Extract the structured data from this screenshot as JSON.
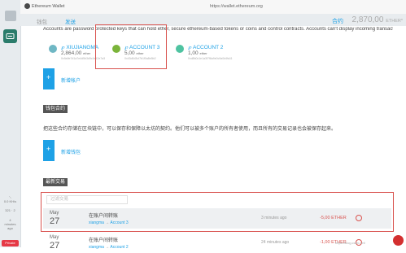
{
  "window": {
    "title": "Ethereum Wallet",
    "url": "https://wallet.ethereum.org"
  },
  "nav": {
    "wallets": "钱包",
    "send": "发送",
    "contracts": "合约",
    "balance": "2,870,00",
    "balance_unit": "ETHER*"
  },
  "sidebar": {
    "peers": "0.0 KH/s",
    "blocks": "321 · 2",
    "time": "4 minutes ago",
    "badge": "Private"
  },
  "info_line": "Accounts are password protected keys that can hold ether, secure ethereum-based tokens or coins and control contracts. Accounts can't display incoming transactions.",
  "accounts": [
    {
      "name": "℘ XIUJIANGMA",
      "balance": "2,864,00",
      "unit": "ether",
      "address": "0x9a9e7d1a7e4d5b3d9c1e12e7a3"
    },
    {
      "name": "℘ ACCOUNT 3",
      "balance": "5,00",
      "unit": "ether",
      "address": "0x43d0d3cf7b1f0a8e5b2"
    },
    {
      "name": "℘ ACCOUNT 2",
      "balance": "1,00",
      "unit": "ether",
      "address": "0xd8b0c1e1a3f7f6a9e0c9a0d4fa11"
    }
  ],
  "new_account": "新增帐户",
  "wallet_contracts": {
    "heading": "钱包合约",
    "description": "把这些合约存储在区块链中，可以保存和保障以太坊的契约。他们可以被多个账户的所有者使用，而且所有的交易记录也会被保存起来。",
    "add_label": "新增钱包"
  },
  "transactions": {
    "heading": "最新交易",
    "filter_placeholder": "过滤交易",
    "rows": [
      {
        "month": "May",
        "day": "27",
        "title": "在账户间转账",
        "from": "xiangma",
        "to": "Account 3",
        "time": "3 minutes ago",
        "amount": "-5,00 ETHER"
      },
      {
        "month": "May",
        "day": "27",
        "title": "在账户间转账",
        "from": "xiangma",
        "to": "Account 2",
        "time": "24 minutes ago",
        "amount": "-1,00 ETHER"
      }
    ]
  },
  "plus": "+",
  "arrow": "→",
  "watermark": "https://blog.csdn.net/",
  "colors": {
    "accent": "#1ea1e6",
    "highlight": "#d9534f",
    "app_green": "#2b7c6b"
  }
}
